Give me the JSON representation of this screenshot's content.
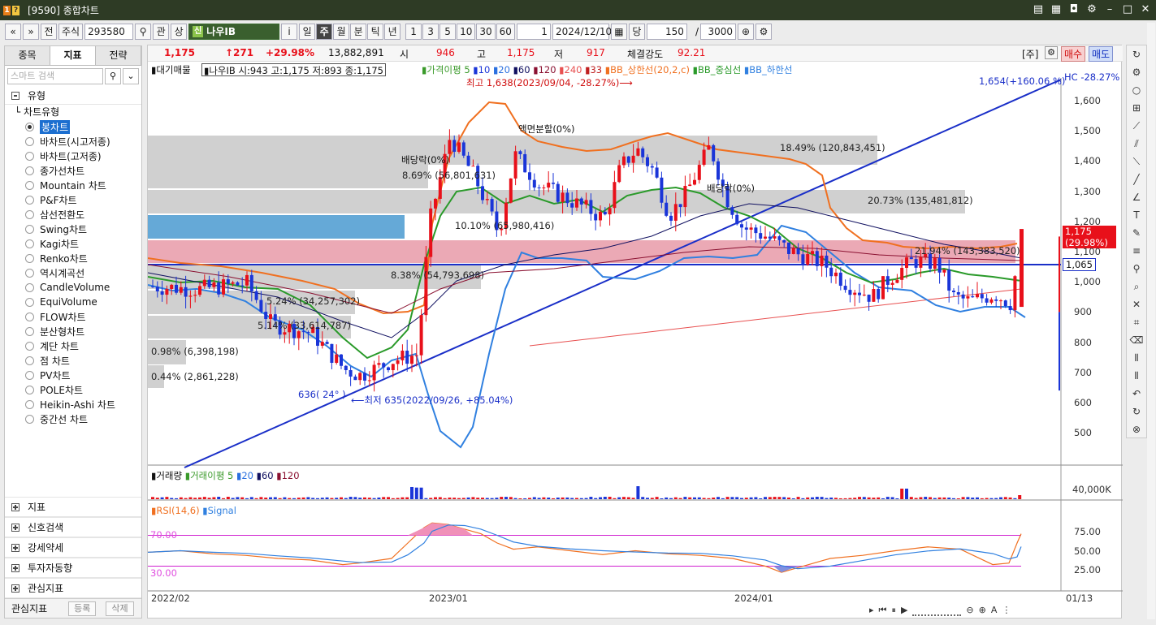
{
  "window": {
    "title": "[9590] 종합차트",
    "logo1": "1",
    "logo2": "?"
  },
  "toolbar": {
    "nav_prev": "«",
    "nav_next": "»",
    "prev_label": "전",
    "type_label": "주식",
    "code": "293580",
    "search": "⚲",
    "gwan": "관",
    "sang": "상",
    "stock_tag": "신",
    "stock_name": "나우IB",
    "info": "i",
    "periods": [
      "일",
      "주",
      "월",
      "분",
      "틱",
      "년"
    ],
    "selected_period": "주",
    "nums": [
      "1",
      "3",
      "5",
      "10",
      "30",
      "60"
    ],
    "num_input": "1",
    "date": "2024/12/10",
    "dang": "당",
    "count": "150",
    "slash": "/",
    "max": "3000"
  },
  "left_panel": {
    "tabs": [
      "종목",
      "지표",
      "전략"
    ],
    "active_tab": "지표",
    "search_placeholder": "스마트 검색",
    "section_type": "유형",
    "tree_parent": "차트유형",
    "chart_types": [
      "봉차트",
      "바차트(시고저종)",
      "바차트(고저종)",
      "종가선차트",
      "Mountain 차트",
      "P&F차트",
      "삼선전환도",
      "Swing차트",
      "Kagi차트",
      "Renko차트",
      "역시계곡선",
      "CandleVolume",
      "EquiVolume",
      "FLOW차트",
      "분산형차트",
      "계단 차트",
      "점 차트",
      "PV차트",
      "POLE차트",
      "Heikin-Ashi 차트",
      "중간선 차트"
    ],
    "selected_type": "봉차트",
    "bottom_sections": [
      "지표",
      "신호검색",
      "강세약세",
      "투자자동향",
      "관심지표"
    ],
    "footer_label": "관심지표",
    "footer_add": "등록",
    "footer_del": "삭제"
  },
  "infobar": {
    "price": "1,175",
    "change": "↑271",
    "change_pct": "+29.98%",
    "volume": "13,882,891",
    "open_label": "시",
    "open": "946",
    "high_label": "고",
    "high": "1,175",
    "low_label": "저",
    "low": "917",
    "strength_label": "체결강도",
    "strength": "92.21",
    "ju": "[주]",
    "buy": "매수",
    "sell": "매도"
  },
  "legend": {
    "vol_profile": "대기매물",
    "ohlc": "나우IB 시:943 고:1,175 저:893 종:1,175",
    "ma_label": "가격이평 5",
    "ma10": "10",
    "ma20": "20",
    "ma60": "60",
    "ma120": "120",
    "ma240": "240",
    "ma33": "33",
    "bb_upper": "BB_상한선(20,2,c)",
    "bb_mid": "BB_중심선",
    "bb_lower": "BB_하한선"
  },
  "annotations": {
    "high": "최고 1,638(2023/09/04, -28.27%)⟶",
    "low": "⟵최저 635(2022/09/26, +85.04%)",
    "trend_end": "1,654(+160.06 %)",
    "hc": "HC -28.27%",
    "angle": "636( 24° )",
    "split": "액면분할(0%)",
    "div1": "배당락(0%)",
    "div2": "배당락(0%)",
    "current_price": "1,175",
    "current_pct": "(29.98%)",
    "hline_value": "1,065"
  },
  "volume_profile": [
    {
      "label": "18.49% (120,843,451)"
    },
    {
      "label": "20.73% (135,481,812)"
    },
    {
      "label": "21.94% (143,383,520)"
    },
    {
      "label": "10.10% (65,980,416)"
    },
    {
      "label": "8.69% (56,801,631)"
    },
    {
      "label": "8.38% (54,793,698)"
    },
    {
      "label": "5.24% (34,257,302)"
    },
    {
      "label": "5.14% (33,614,787)"
    },
    {
      "label": "0.98% (6,398,198)"
    },
    {
      "label": "0.44% (2,861,228)"
    }
  ],
  "price_axis": [
    "1,600",
    "1,500",
    "1,400",
    "1,300",
    "1,200",
    "1,100",
    "1,000",
    "900",
    "800",
    "700",
    "600",
    "500"
  ],
  "volume_panel": {
    "title": "거래량",
    "ma5": "거래이평 5",
    "ma20": "20",
    "ma60": "60",
    "ma120": "120",
    "axis": "40,000K"
  },
  "rsi_panel": {
    "title": "RSI(14,6)",
    "signal": "Signal",
    "upper": "70.00",
    "lower": "30.00",
    "axis": [
      "75.00",
      "50.00",
      "25.00"
    ]
  },
  "x_axis": [
    "2022/02",
    "2023/01",
    "2024/01",
    "01/13"
  ],
  "colors": {
    "up": "#E8101A",
    "down": "#1A35D8",
    "bb_upper": "#F07020",
    "bb_lower": "#3080E0",
    "ma20": "#2A9A2A",
    "trendline": "#1A2FC8"
  }
}
